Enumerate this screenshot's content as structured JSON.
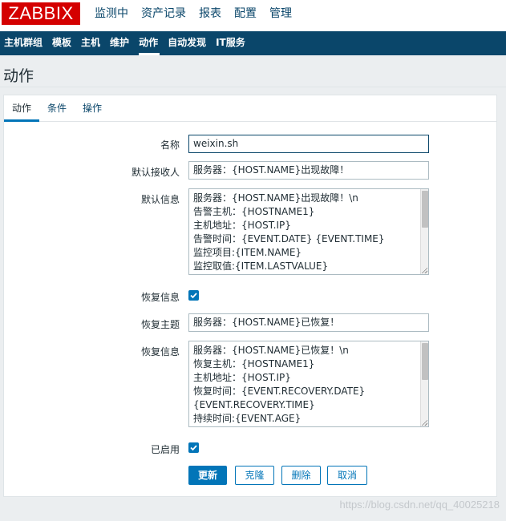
{
  "logo": {
    "text": "ZABBIX"
  },
  "top_menu": [
    {
      "label": "监测中"
    },
    {
      "label": "资产记录"
    },
    {
      "label": "报表"
    },
    {
      "label": "配置"
    },
    {
      "label": "管理"
    }
  ],
  "sub_menu": [
    {
      "label": "主机群组"
    },
    {
      "label": "模板"
    },
    {
      "label": "主机"
    },
    {
      "label": "维护"
    },
    {
      "label": "动作"
    },
    {
      "label": "自动发现"
    },
    {
      "label": "IT服务"
    }
  ],
  "page": {
    "title": "动作"
  },
  "tabs": [
    {
      "label": "动作"
    },
    {
      "label": "条件"
    },
    {
      "label": "操作"
    }
  ],
  "form": {
    "name": {
      "label": "名称",
      "value": "weixin.sh"
    },
    "default_recipient": {
      "label": "默认接收人",
      "value": "服务器：{HOST.NAME}出现故障！"
    },
    "default_message": {
      "label": "默认信息",
      "lines": [
        "服务器：{HOST.NAME}出现故障！\\n",
        "告警主机：{HOSTNAME1}",
        "主机地址：{HOST.IP}",
        "告警时间：{EVENT.DATE} {EVENT.TIME}",
        "监控项目:{ITEM.NAME}",
        "监控取值:{ITEM.LASTVALUE}"
      ]
    },
    "recovery_message_toggle": {
      "label": "恢复信息",
      "checked": true
    },
    "recovery_subject": {
      "label": "恢复主题",
      "value": "服务器：{HOST.NAME}已恢复！"
    },
    "recovery_message": {
      "label": "恢复信息",
      "lines": [
        "服务器：{HOST.NAME}已恢复！\\n",
        "恢复主机：{HOSTNAME1}",
        "主机地址：{HOST.IP}",
        "恢复时间：{EVENT.RECOVERY.DATE}",
        "{EVENT.RECOVERY.TIME}",
        "持续时间:{EVENT.AGE}"
      ]
    },
    "enabled": {
      "label": "已启用",
      "checked": true
    }
  },
  "buttons": {
    "update": "更新",
    "clone": "克隆",
    "delete": "删除",
    "cancel": "取消"
  },
  "watermark": "https://blog.csdn.net/qq_40025218",
  "colors": {
    "brand_red": "#d40000",
    "nav_dark": "#0a466a",
    "accent_blue": "#0275b8"
  }
}
